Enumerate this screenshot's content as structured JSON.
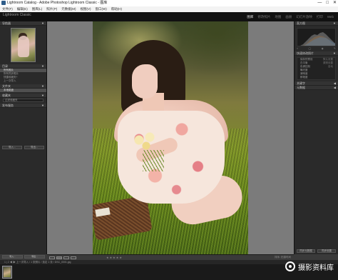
{
  "window": {
    "title": "Lightroom Catalog - Adobe Photoshop Lightroom Classic - 图库",
    "controls": [
      "—",
      "□",
      "✕"
    ]
  },
  "menu": [
    "文件(F)",
    "编辑(E)",
    "图库(L)",
    "照片(P)",
    "元数据(M)",
    "视图(V)",
    "窗口(W)",
    "帮助(H)"
  ],
  "identity": {
    "line1": "Lightroom Classic",
    "modules": [
      "图库",
      "修改照片",
      "地图",
      "画册",
      "幻灯片放映",
      "打印",
      "Web"
    ]
  },
  "left": {
    "navigator_title": "导航器",
    "navigator_zoom": "适合 填满 100%",
    "rows": [
      "目录",
      "所有照片",
      "所有同步照片",
      "快捷收藏夹+",
      "上一次导入",
      "文件夹",
      "本地磁盘",
      "收藏夹",
      "发布服务"
    ],
    "field_text": "过滤收藏夹",
    "import_label": "导入...",
    "export_label": "导出..."
  },
  "right": {
    "histogram_title": "直方图",
    "quick_develop": "快速修改照片",
    "rows": [
      {
        "label": "保存的预设",
        "value": "默认设置"
      },
      {
        "label": "白平衡",
        "value": "原照设置"
      },
      {
        "label": "色调控制",
        "value": "自动"
      },
      {
        "label": "曝光度",
        "value": ""
      },
      {
        "label": "清晰度",
        "value": ""
      },
      {
        "label": "鲜艳度",
        "value": ""
      }
    ],
    "keywords": "关键字",
    "metadata": "元数据",
    "sync_meta": "同步元数据",
    "sync_settings": "同步设置"
  },
  "toolbar": {
    "stars": "★★★★★",
    "sort": "排序: 拍摄时间"
  },
  "bottom": {
    "btn1": "导入...",
    "btn2": "导出..."
  },
  "filmstrip": {
    "path": "1 | 2 ◀ ▶  上一次导入 / 1 张照片 / 选定 1 张 / DSC_0001.jpg"
  },
  "watermark": {
    "text": "摄影资料库"
  }
}
